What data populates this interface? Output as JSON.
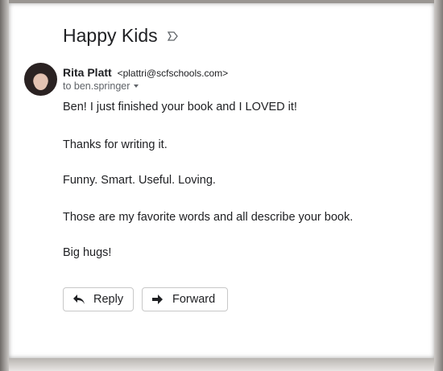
{
  "email": {
    "subject": "Happy Kids",
    "label_icon": "label-arrow-icon",
    "sender": {
      "name": "Rita Platt",
      "email": "<plattri@scfschools.com>",
      "to": "to ben.springer"
    },
    "body": [
      "Ben! I just finished your book and I LOVED it!",
      "Thanks for writing it.",
      "Funny. Smart. Useful. Loving.",
      "Those are my favorite words and all describe your book.",
      "Big hugs!"
    ],
    "actions": {
      "reply_label": "Reply",
      "forward_label": "Forward"
    }
  }
}
